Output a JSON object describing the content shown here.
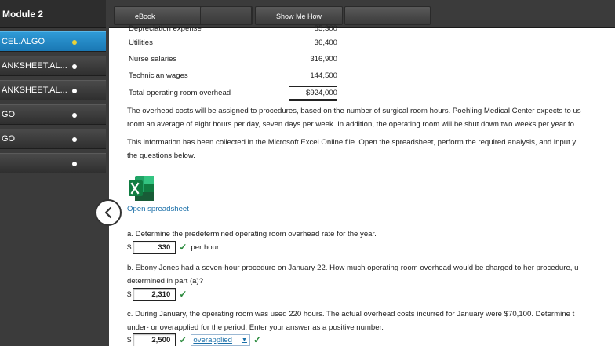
{
  "sidebar": {
    "title": "Module 2",
    "items": [
      {
        "label": "CEL.ALGO",
        "active": true
      },
      {
        "label": "ANKSHEET.AL...",
        "active": false
      },
      {
        "label": "ANKSHEET.AL...",
        "active": false
      },
      {
        "label": "GO",
        "active": false
      },
      {
        "label": "GO",
        "active": false
      },
      {
        "label": "",
        "active": false
      }
    ]
  },
  "toolbar": {
    "ebook_label": "eBook",
    "show_me_how_label": "Show Me How"
  },
  "table": {
    "rows": [
      {
        "label": "Depreciation expense",
        "value": "85,300"
      },
      {
        "label": "Utilities",
        "value": "36,400"
      },
      {
        "label": "Nurse salaries",
        "value": "316,900"
      },
      {
        "label": "Technician wages",
        "value": "144,500"
      }
    ],
    "total": {
      "label": "Total operating room overhead",
      "value": "$924,000"
    }
  },
  "text": {
    "p1_line1": "The overhead costs will be assigned to procedures, based on the number of surgical room hours. Poehling Medical Center expects to us",
    "p1_line2": "room an average of eight hours per day, seven days per week. In addition, the operating room will be shut down two weeks per year fo",
    "p2_line1": "This information has been collected in the Microsoft Excel Online file. Open the spreadsheet, perform the required analysis, and input y",
    "p2_line2": "the questions below.",
    "open_spreadsheet": "Open spreadsheet"
  },
  "questions": {
    "a": {
      "line1": "a.  Determine the predetermined operating room overhead rate for the year.",
      "currency": "$",
      "answer": "330",
      "unit": "per hour"
    },
    "b": {
      "line1": "b.  Ebony Jones had a seven-hour procedure on January 22. How much operating room overhead would be charged to her procedure, u",
      "line2": "determined in part (a)?",
      "currency": "$",
      "answer": "2,310"
    },
    "c": {
      "line1": "c.  During January, the operating room was used 220 hours. The actual overhead costs incurred for January were $70,100. Determine t",
      "line2": "under- or overapplied for the period. Enter your answer as a positive number.",
      "currency": "$",
      "answer": "2,500",
      "dropdown_selected": "overapplied"
    }
  },
  "icons": {
    "check": "check-icon",
    "excel": "excel-icon",
    "collapse": "chevron-left-icon"
  },
  "colors": {
    "sidebar_bg": "#3b3b3b",
    "active_item": "#2f9ad6",
    "link": "#1a6fa8",
    "check": "#2a8a3c"
  }
}
